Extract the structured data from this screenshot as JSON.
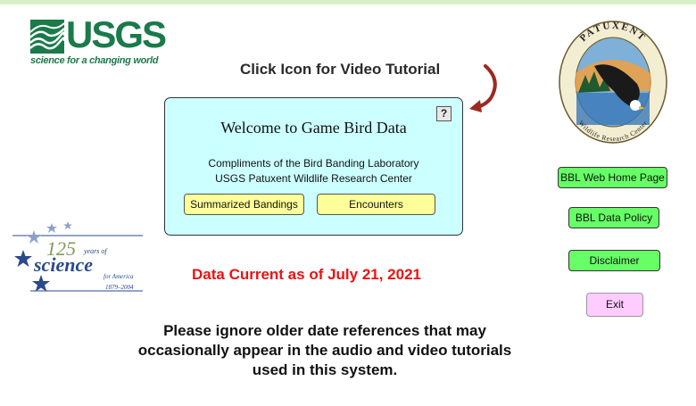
{
  "header": {
    "logo_text": "USGS",
    "logo_tagline": "science for a changing world",
    "tutorial_prompt": "Click Icon for Video Tutorial"
  },
  "seal": {
    "top_text": "PATUXENT",
    "bottom_text": "Wildlife Research Center"
  },
  "panel": {
    "help_icon": "?",
    "title": "Welcome to Game Bird Data",
    "line1": "Compliments of the Bird Banding Laboratory",
    "line2": "USGS Patuxent Wildlife Research Center",
    "btn_summarized": "Summarized Bandings",
    "btn_encounters": "Encounters"
  },
  "anniversary": {
    "number": "125",
    "years_of": "years of",
    "science": "science",
    "for_america": "for America",
    "dates": "1879–2004"
  },
  "status": {
    "data_current": "Data Current  as of July 21, 2021",
    "notice": "Please ignore older date references that may occasionally appear in the audio and video tutorials used in this system."
  },
  "sidebar": {
    "web_home": "BBL Web Home Page",
    "data_policy": "BBL Data Policy",
    "disclaimer": "Disclaimer",
    "exit": "Exit"
  },
  "colors": {
    "panel_bg": "#ccffff",
    "yellow_button": "#ffff99",
    "green_button": "#66ff66",
    "exit_button": "#ffccff",
    "alert_red": "#ee1111",
    "usgs_green": "#1a7a4a"
  }
}
